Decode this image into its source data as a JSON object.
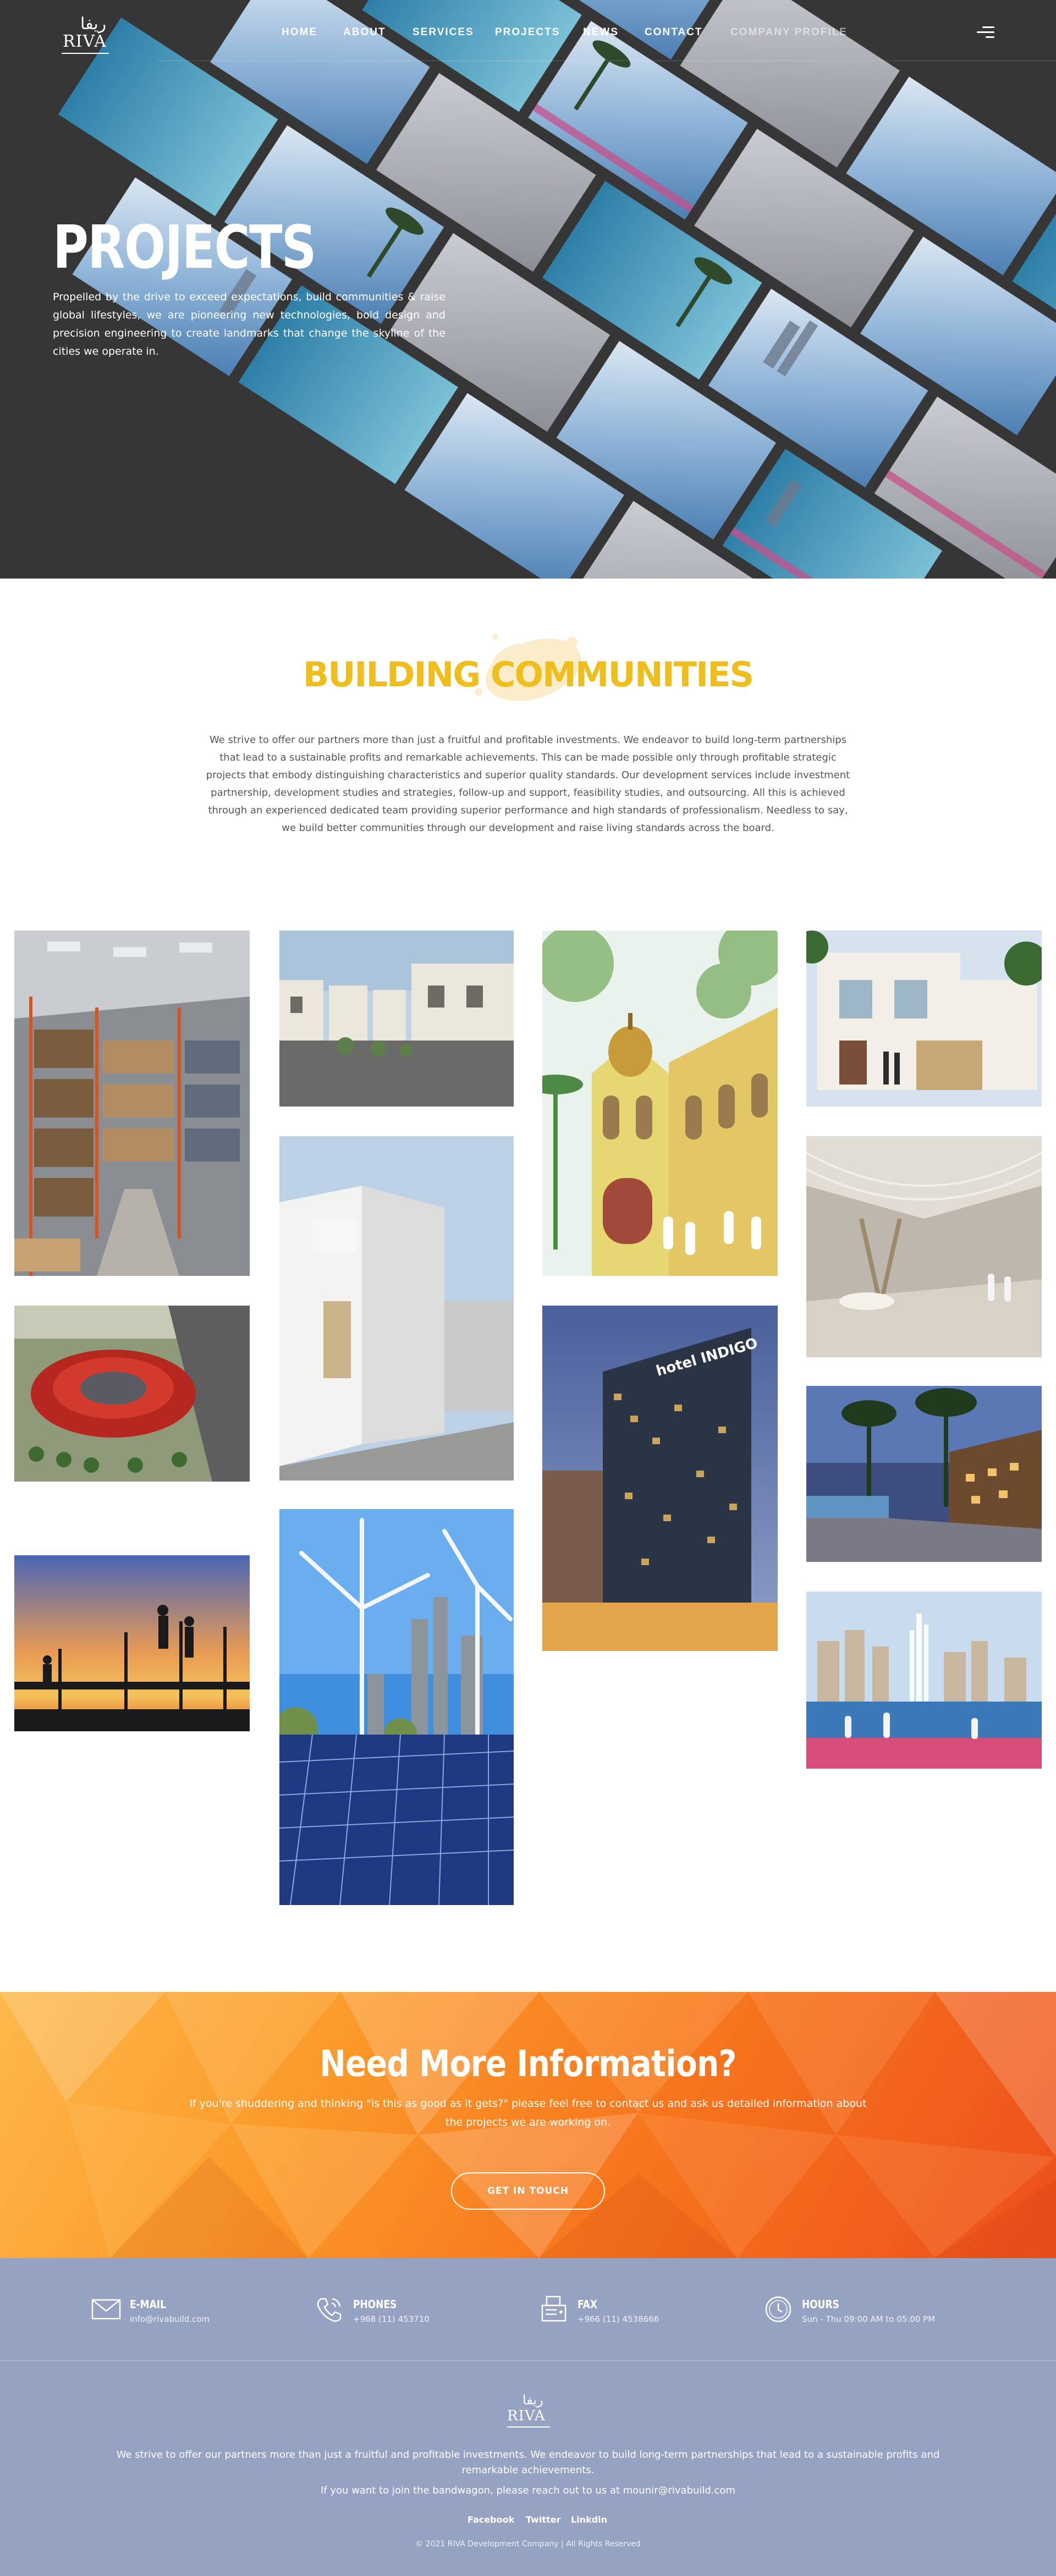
{
  "brand": {
    "logo_text": "RIVA",
    "logo_arabic": "ريفا"
  },
  "nav": {
    "items": [
      {
        "label": "HOME"
      },
      {
        "label": "ABOUT"
      },
      {
        "label": "SERVICES"
      },
      {
        "label": "PROJECTS"
      },
      {
        "label": "NEWS"
      },
      {
        "label": "CONTACT"
      },
      {
        "label": "COMPANY PROFILE"
      }
    ],
    "menu_icon": "hamburger-menu-icon"
  },
  "hero": {
    "title": "PROJECTS",
    "text": "Propelled by the drive to exceed expectations, build communities & raise global lifestyles, we are pioneering new technologies, bold design and precision engineering to create landmarks that change the skyline of the cities we operate in."
  },
  "communities": {
    "title": "BUILDING COMMUNITIES",
    "text": "We strive to offer our partners more than just a fruitful and profitable investments. We endeavor to build long-term partnerships that lead to a sustainable profits and remarkable achievements. This can be made possible only through profitable strategic projects that embody distinguishing characteristics and superior quality standards. Our development services include investment partnership, development studies and strategies, follow-up and support, feasibility studies, and outsourcing. All this is achieved through an experienced dedicated team providing superior performance and high standards of professionalism. Needless to say, we build better communities through our development and raise living standards across the board."
  },
  "gallery": {
    "images": [
      "warehouse-photo",
      "villas-photo",
      "heritage-building-illustration",
      "townhouse-photo",
      "round-building-render",
      "white-building-photo",
      "hotel-indigo-photo",
      "lobby-render",
      "construction-silhouette-photo",
      "wind-solar-photo",
      "waterfront-promenade-photo",
      "lagoon-fountain-photo"
    ],
    "hotel_sign": "hotel INDIGO"
  },
  "cta": {
    "title": "Need More Information?",
    "text": "If you're shuddering and thinking \"is this as good as it gets?\" please feel free to contact us and ask us detailed information about the projects we are working on.",
    "button": "GET IN TOUCH"
  },
  "footer": {
    "contacts": [
      {
        "icon": "envelope-icon",
        "label": "E-MAIL",
        "value": "info@rivabuild.com"
      },
      {
        "icon": "phone-icon",
        "label": "PHONES",
        "value": "+968 (11) 453710"
      },
      {
        "icon": "fax-icon",
        "label": "FAX",
        "value": "+966 (11) 4538666"
      },
      {
        "icon": "clock-icon",
        "label": "HOURS",
        "value": "Sun - Thu 09:00 AM to 05:00 PM"
      }
    ],
    "text": "We strive to offer our partners more than just a fruitful and profitable investments. We endeavor to build long-term partnerships that lead to a sustainable profits and remarkable achievements.",
    "text2": "If you want to join the bandwagon, please reach out to us at mounir@rivabuild.com",
    "social": [
      {
        "label": "Facebook"
      },
      {
        "label": "Twitter"
      },
      {
        "label": "Linkdin"
      }
    ],
    "copyright": "© 2021 RIVA Development Company | All Rights Reserved"
  },
  "colors": {
    "hero_bg": "#363636",
    "accent_yellow": "#f0be1c",
    "cta_orange": "#f7761d",
    "footer_bg": "#96a2c2"
  }
}
